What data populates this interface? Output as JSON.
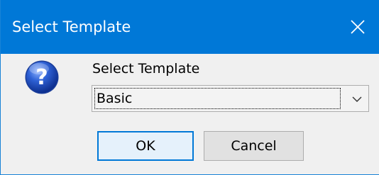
{
  "window": {
    "title": "Select Template"
  },
  "prompt": {
    "label": "Select Template"
  },
  "template_select": {
    "selected": "Basic"
  },
  "buttons": {
    "ok_label": "OK",
    "cancel_label": "Cancel"
  },
  "icons": {
    "dialog_icon": "question-icon",
    "close_icon": "close-icon",
    "dropdown_icon": "chevron-down-icon"
  },
  "colors": {
    "titlebar": "#0078d7",
    "title_text": "#ffffff",
    "dialog_background": "#f0f0f0",
    "default_button_border": "#0078d7"
  }
}
